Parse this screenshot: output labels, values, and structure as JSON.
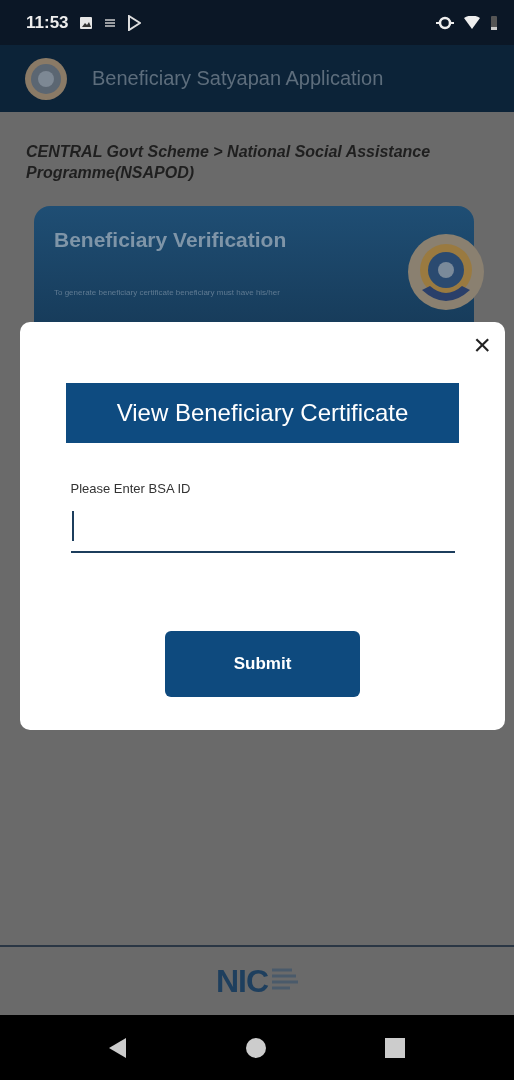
{
  "status_bar": {
    "time": "11:53"
  },
  "app_bar": {
    "title": "Beneficiary Satyapan Application"
  },
  "breadcrumb": "CENTRAL Govt Scheme > National Social Assistance Programme(NSAPOD)",
  "card": {
    "title": "Beneficiary Verification",
    "text": "To generate beneficiary certificate beneficiary must have his/her"
  },
  "dialog": {
    "close": "×",
    "title": "View Beneficiary Certificate",
    "field": {
      "label": "Please Enter BSA ID",
      "focused": true
    },
    "button": "Submit"
  },
  "footer": {
    "logo": "NIC"
  }
}
